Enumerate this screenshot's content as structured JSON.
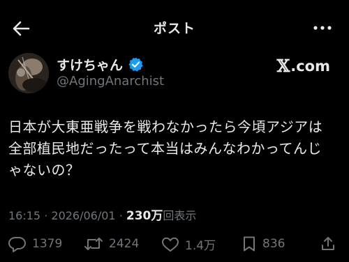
{
  "header": {
    "title": "ポスト",
    "back_icon": "arrow-left-icon",
    "more_icon": "more-horizontal-icon"
  },
  "author": {
    "name": "すけちゃん",
    "handle": "@AgingAnarchist",
    "verified": true,
    "verified_color": "#1d9bf0"
  },
  "brand": {
    "logo_text": "𝕏",
    "suffix": ".com"
  },
  "post": {
    "lines": [
      "日本が大東亜戦争を戦わなかったら今頃アジアは",
      "全部植民地だったって本当はみんなわかってんじ",
      "ゃないの？"
    ]
  },
  "meta": {
    "time": "16:15",
    "separator": "·",
    "date": "2026/06/01",
    "views_count": "230万",
    "views_label": "回表示"
  },
  "actions": {
    "reply_count": "1379",
    "repost_count": "2424",
    "like_count": "1.4万",
    "bookmark_count": "836"
  },
  "colors": {
    "background": "#000000",
    "text_primary": "#e7e9ea",
    "text_secondary": "#71767b",
    "accent": "#1d9bf0"
  }
}
